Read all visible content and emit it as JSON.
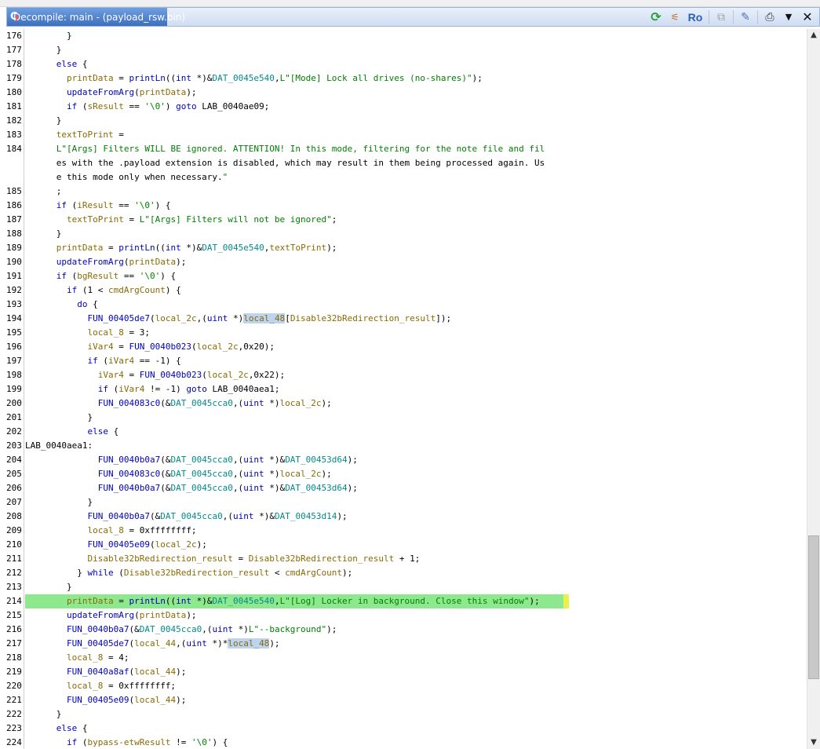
{
  "window": {
    "title": "Decompile: main -  (payload_rsw.bin)",
    "toolbar": {
      "refresh_icon": "refresh-icon",
      "ro_label": "Ro"
    }
  },
  "scroll": {
    "position_fraction": 0.7
  },
  "highlight": {
    "line": "214",
    "color": "#8ee88e"
  },
  "code": {
    "lines": [
      {
        "n": "176",
        "t": "        }"
      },
      {
        "n": "177",
        "t": "      }"
      },
      {
        "n": "178",
        "t": "      else {"
      },
      {
        "n": "179",
        "t": "        printData = printLn((int *)&DAT_0045e540,L\"[Mode] Lock all drives (no-shares)\");"
      },
      {
        "n": "180",
        "t": "        updateFromArg(printData);"
      },
      {
        "n": "181",
        "t": "        if (sResult == '\\0') goto LAB_0040ae09;"
      },
      {
        "n": "182",
        "t": "      }"
      },
      {
        "n": "183",
        "t": "      textToPrint ="
      },
      {
        "n": "184",
        "t": "      L\"[Args] Filters WILL BE ignored. ATTENTION! In this mode, filtering for the note file and fil"
      },
      {
        "n": "",
        "t": "      es with the .payload extension is disabled, which may result in them being processed again. Us"
      },
      {
        "n": "",
        "t": "      e this mode only when necessary.\""
      },
      {
        "n": "185",
        "t": "      ;"
      },
      {
        "n": "186",
        "t": "      if (iResult == '\\0') {"
      },
      {
        "n": "187",
        "t": "        textToPrint = L\"[Args] Filters will not be ignored\";"
      },
      {
        "n": "188",
        "t": "      }"
      },
      {
        "n": "189",
        "t": "      printData = printLn((int *)&DAT_0045e540,textToPrint);"
      },
      {
        "n": "190",
        "t": "      updateFromArg(printData);"
      },
      {
        "n": "191",
        "t": "      if (bgResult == '\\0') {"
      },
      {
        "n": "192",
        "t": "        if (1 < cmdArgCount) {"
      },
      {
        "n": "193",
        "t": "          do {"
      },
      {
        "n": "194",
        "t": "            FUN_00405de7(local_2c,(uint *)local_48[Disable32bRedirection_result]);"
      },
      {
        "n": "195",
        "t": "            local_8 = 3;"
      },
      {
        "n": "196",
        "t": "            iVar4 = FUN_0040b023(local_2c,0x20);"
      },
      {
        "n": "197",
        "t": "            if (iVar4 == -1) {"
      },
      {
        "n": "198",
        "t": "              iVar4 = FUN_0040b023(local_2c,0x22);"
      },
      {
        "n": "199",
        "t": "              if (iVar4 != -1) goto LAB_0040aea1;"
      },
      {
        "n": "200",
        "t": "              FUN_004083c0(&DAT_0045cca0,(uint *)local_2c);"
      },
      {
        "n": "201",
        "t": "            }"
      },
      {
        "n": "202",
        "t": "            else {"
      },
      {
        "n": "203",
        "t": "LAB_0040aea1:"
      },
      {
        "n": "204",
        "t": "              FUN_0040b0a7(&DAT_0045cca0,(uint *)&DAT_00453d64);"
      },
      {
        "n": "205",
        "t": "              FUN_004083c0(&DAT_0045cca0,(uint *)local_2c);"
      },
      {
        "n": "206",
        "t": "              FUN_0040b0a7(&DAT_0045cca0,(uint *)&DAT_00453d64);"
      },
      {
        "n": "207",
        "t": "            }"
      },
      {
        "n": "208",
        "t": "            FUN_0040b0a7(&DAT_0045cca0,(uint *)&DAT_00453d14);"
      },
      {
        "n": "209",
        "t": "            local_8 = 0xffffffff;"
      },
      {
        "n": "210",
        "t": "            FUN_00405e09(local_2c);"
      },
      {
        "n": "211",
        "t": "            Disable32bRedirection_result = Disable32bRedirection_result + 1;"
      },
      {
        "n": "212",
        "t": "          } while (Disable32bRedirection_result < cmdArgCount);"
      },
      {
        "n": "213",
        "t": "        }"
      },
      {
        "n": "214",
        "t": "        printData = printLn((int *)&DAT_0045e540,L\"[Log] Locker in background. Close this window\");"
      },
      {
        "n": "215",
        "t": "        updateFromArg(printData);"
      },
      {
        "n": "216",
        "t": "        FUN_0040b0a7(&DAT_0045cca0,(uint *)L\"--background\");"
      },
      {
        "n": "217",
        "t": "        FUN_00405de7(local_44,(uint *)*local_48);"
      },
      {
        "n": "218",
        "t": "        local_8 = 4;"
      },
      {
        "n": "219",
        "t": "        FUN_0040a8af(local_44);"
      },
      {
        "n": "220",
        "t": "        local_8 = 0xffffffff;"
      },
      {
        "n": "221",
        "t": "        FUN_00405e09(local_44);"
      },
      {
        "n": "222",
        "t": "      }"
      },
      {
        "n": "223",
        "t": "      else {"
      },
      {
        "n": "224",
        "t": "        if (bypass-etwResult != '\\0') {"
      }
    ]
  }
}
